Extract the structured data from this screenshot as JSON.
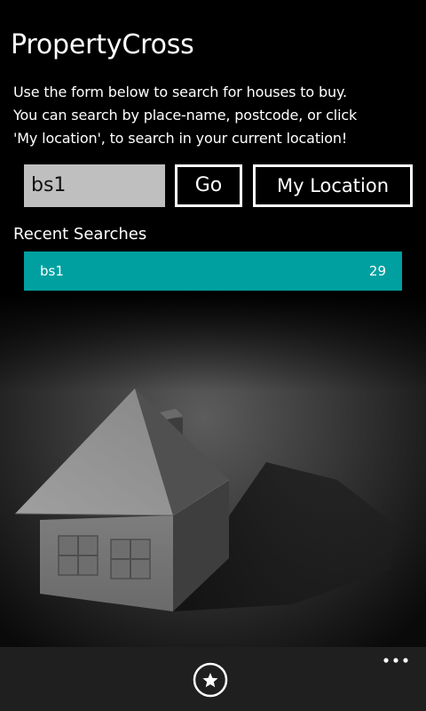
{
  "app": {
    "title": "PropertyCross"
  },
  "intro": {
    "lines": [
      "Use the form below to search for houses to buy.",
      "You can search by place-name, postcode, or click",
      "'My location', to search in your current location!"
    ]
  },
  "search": {
    "value": "bs1",
    "go_label": "Go",
    "location_label": "My Location"
  },
  "recent": {
    "heading": "Recent Searches",
    "items": [
      {
        "term": "bs1",
        "count": "29"
      }
    ]
  },
  "appbar": {
    "favourites_icon": "star-icon",
    "more_icon": "ellipsis-icon"
  },
  "colors": {
    "accent": "#00a0a0",
    "background": "#000000",
    "appbar": "#1f1f1f",
    "input": "#bfbfbf"
  }
}
